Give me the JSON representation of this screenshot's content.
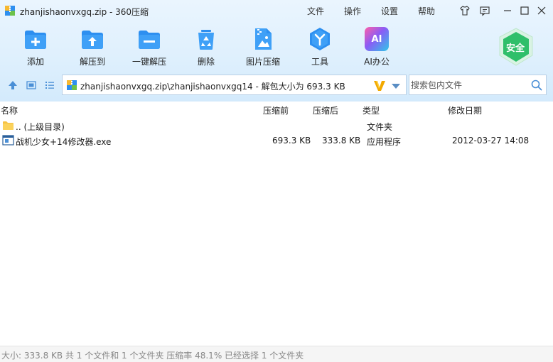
{
  "window": {
    "title": "zhanjishaonvxgq.zip - 360压缩",
    "menus": [
      "文件",
      "操作",
      "设置",
      "帮助"
    ]
  },
  "toolbar": {
    "items": [
      {
        "label": "添加",
        "icon": "add-archive-icon"
      },
      {
        "label": "解压到",
        "icon": "extract-to-icon"
      },
      {
        "label": "一键解压",
        "icon": "one-click-extract-icon"
      },
      {
        "label": "删除",
        "icon": "recycle-delete-icon"
      },
      {
        "label": "图片压缩",
        "icon": "image-compress-icon"
      },
      {
        "label": "工具",
        "icon": "tools-icon"
      },
      {
        "label": "AI办公",
        "icon": "ai-office-icon"
      }
    ],
    "ai_glyph": "AI",
    "security_badge": "安全"
  },
  "address": {
    "path": "zhanjishaonvxgq.zip\\zhanjishaonvxgq14 - 解包大小为 693.3 KB"
  },
  "search": {
    "placeholder": "搜索包内文件"
  },
  "columns": {
    "name": "名称",
    "before": "压缩前",
    "after": "压缩后",
    "type": "类型",
    "modified": "修改日期"
  },
  "files": [
    {
      "name": ".. (上级目录)",
      "before": "",
      "after": "",
      "type": "文件夹",
      "modified": "",
      "icon": "folder-icon"
    },
    {
      "name": "战机少女+14修改器.exe",
      "before": "693.3 KB",
      "after": "333.8 KB",
      "type": "应用程序",
      "modified": "2012-03-27 14:08",
      "icon": "exe-file-icon"
    }
  ],
  "status": {
    "text": "大小: 333.8 KB 共 1 个文件和 1 个文件夹 压缩率 48.1% 已经选择 1 个文件夹"
  },
  "colors": {
    "accent_blue": "#2d8ff0",
    "header_bg": "#dff0fd",
    "shield_green": "#2fbf6a"
  }
}
